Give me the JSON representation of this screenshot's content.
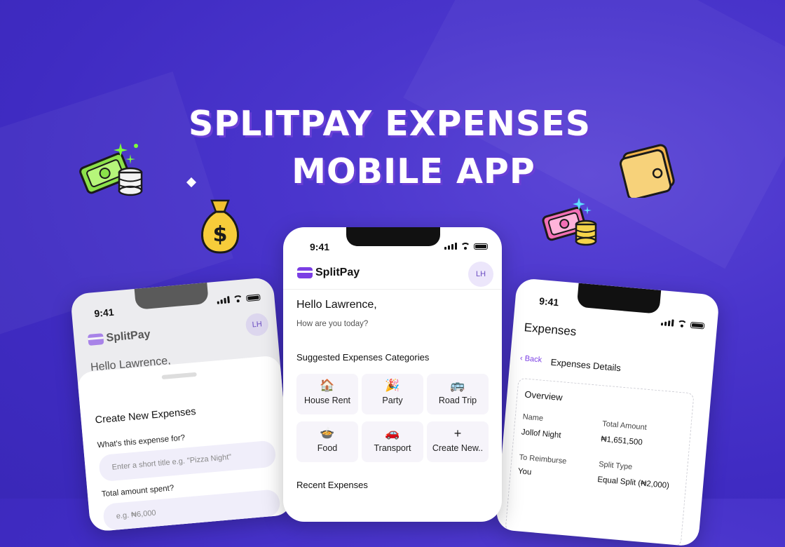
{
  "hero": {
    "line1": "SPLITPAY EXPENSES",
    "line2": "MOBILE APP"
  },
  "status": {
    "time": "9:41"
  },
  "app": {
    "name": "SplitPay",
    "avatar_initials": "LH"
  },
  "home": {
    "greeting": "Hello Lawrence,",
    "subtitle": "How are you today?",
    "categories_title": "Suggested Expenses Categories",
    "categories": [
      {
        "label": "House Rent",
        "icon": "house-icon"
      },
      {
        "label": "Party",
        "icon": "party-popper-icon"
      },
      {
        "label": "Road Trip",
        "icon": "bus-icon"
      },
      {
        "label": "Food",
        "icon": "food-bowl-icon"
      },
      {
        "label": "Transport",
        "icon": "car-icon"
      },
      {
        "label": "Create New..",
        "icon": "plus-icon"
      }
    ],
    "recent_title": "Recent Expenses"
  },
  "create_sheet": {
    "behind_text": "Hello Lawrence,",
    "title": "Create New Expenses",
    "q1_label": "What's this expense for?",
    "q1_placeholder": "Enter a short title e.g. \"Pizza Night\"",
    "q2_label": "Total amount spent?",
    "q2_placeholder": "e.g. ₦6,000"
  },
  "details": {
    "title": "Expenses",
    "back_label": "Back",
    "subtitle": "Expenses Details",
    "card_title": "Overview",
    "name_label": "Name",
    "name_value": "Jollof Night",
    "total_label": "Total Amount",
    "total_value": "₦1,651,500",
    "reimburse_label": "To Reimburse",
    "reimburse_value": "You",
    "split_label": "Split Type",
    "split_value": "Equal Split (₦2,000)"
  },
  "colors": {
    "background": "#4a35cc",
    "accent": "#7b3fe4",
    "hero_text": "#ffffff"
  }
}
